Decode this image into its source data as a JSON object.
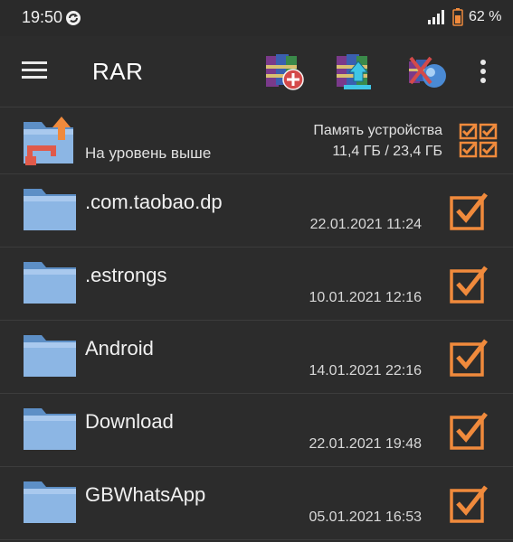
{
  "status_bar": {
    "time": "19:50",
    "battery": "62 %",
    "icons": [
      "sync-icon",
      "signal-icon",
      "battery-icon"
    ]
  },
  "app_bar": {
    "title": "RAR",
    "icons": [
      "menu-icon",
      "archive-add-icon",
      "archive-extract-icon",
      "archive-tools-icon",
      "more-vert-icon"
    ]
  },
  "parent_row": {
    "label": "На уровень выше",
    "storage_title": "Память устройства",
    "storage_value": "11,4 ГБ / 23,4 ГБ"
  },
  "files": [
    {
      "name": ".com.taobao.dp",
      "date": "22.01.2021 11:24"
    },
    {
      "name": ".estrongs",
      "date": "10.01.2021 12:16"
    },
    {
      "name": "Android",
      "date": "14.01.2021 22:16"
    },
    {
      "name": "Download",
      "date": "22.01.2021 19:48"
    },
    {
      "name": "GBWhatsApp",
      "date": "05.01.2021 16:53"
    }
  ],
  "colors": {
    "background": "#2c2c2c",
    "divider": "#3c3c3c",
    "checkbox": "#f08a3c",
    "folder": "#6f9fd4",
    "text": "#f0f0f0"
  }
}
